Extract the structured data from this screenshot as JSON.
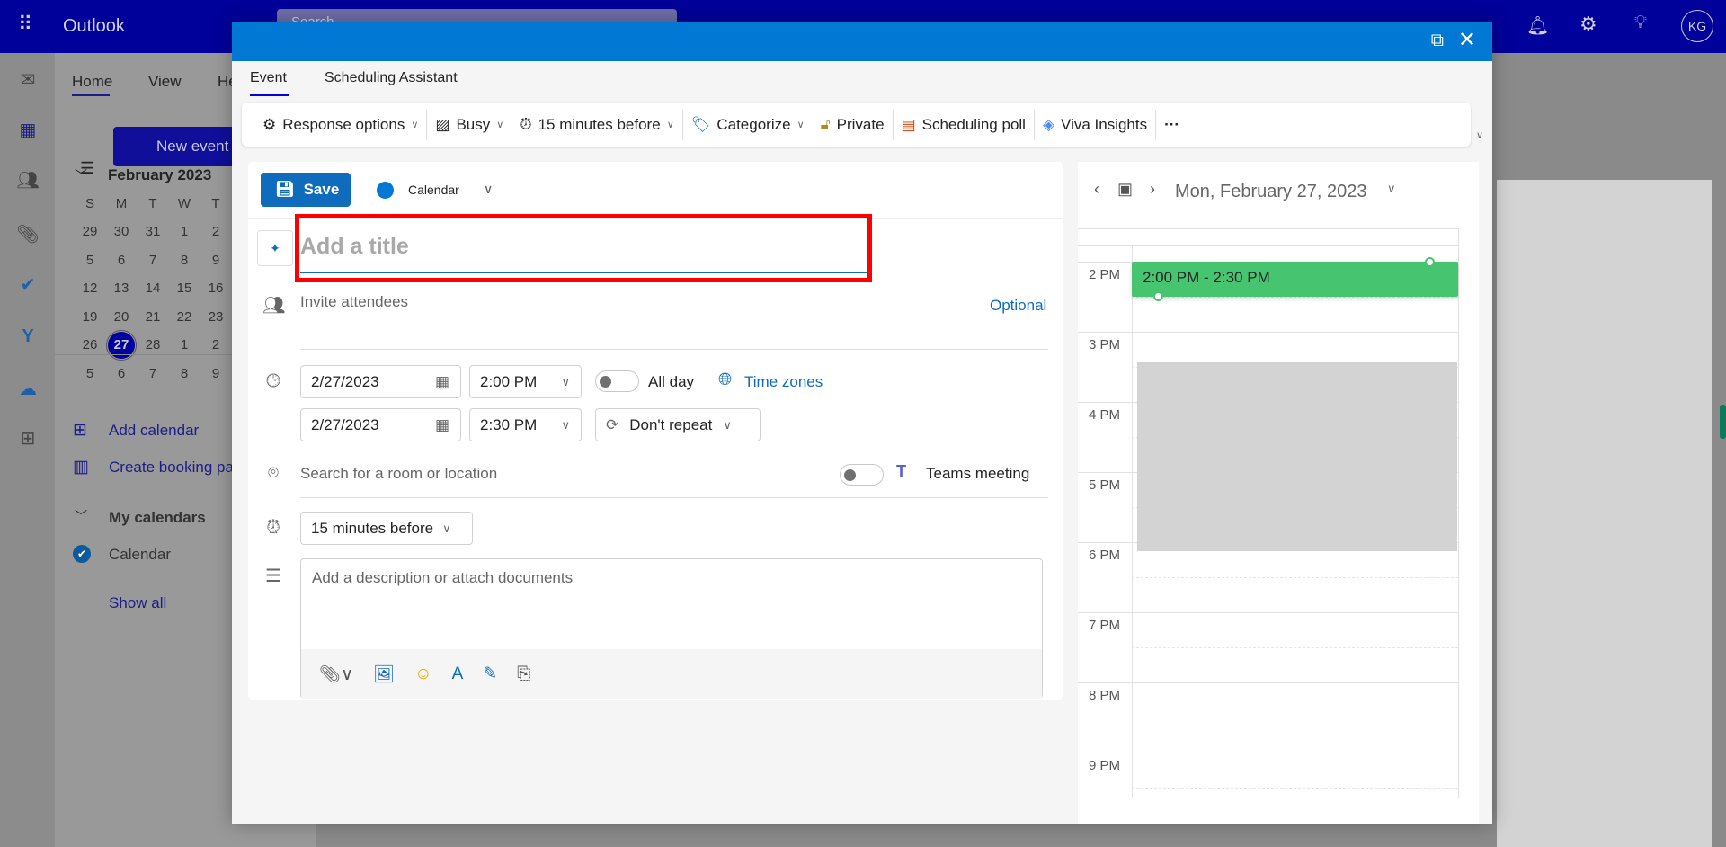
{
  "app": {
    "name": "Outlook",
    "user_initials": "KG",
    "search_placeholder": "Search"
  },
  "ribbon_tabs": [
    "Home",
    "View",
    "He"
  ],
  "new_event_label": "New event",
  "mini_calendar": {
    "title": "February 2023",
    "weekdays": [
      "S",
      "M",
      "T",
      "W",
      "T"
    ],
    "weeks": [
      [
        "29",
        "30",
        "31",
        "1",
        "2"
      ],
      [
        "5",
        "6",
        "7",
        "8",
        "9"
      ],
      [
        "12",
        "13",
        "14",
        "15",
        "16"
      ],
      [
        "19",
        "20",
        "21",
        "22",
        "23"
      ],
      [
        "26",
        "27",
        "28",
        "1",
        "2"
      ],
      [
        "5",
        "6",
        "7",
        "8",
        "9"
      ]
    ],
    "selected": "27"
  },
  "sidebar": {
    "add_calendar": "Add calendar",
    "create_booking": "Create booking pa",
    "my_calendars": "My calendars",
    "calendar": "Calendar",
    "show_all": "Show all"
  },
  "modal": {
    "tabs": [
      "Event",
      "Scheduling Assistant"
    ],
    "toolbar": {
      "response_options": "Response options",
      "busy": "Busy",
      "reminder": "15 minutes before",
      "categorize": "Categorize",
      "private": "Private",
      "scheduling_poll": "Scheduling poll",
      "viva_insights": "Viva Insights",
      "more": "···"
    },
    "save": "Save",
    "calendar_select": "Calendar",
    "calendar_color": "#0078d4",
    "title_placeholder": "Add a title",
    "invite_placeholder": "Invite attendees",
    "optional": "Optional",
    "start_date": "2/27/2023",
    "start_time": "2:00 PM",
    "end_date": "2/27/2023",
    "end_time": "2:30 PM",
    "all_day": "All day",
    "all_day_on": false,
    "time_zones": "Time zones",
    "repeat": "Don't repeat",
    "location_placeholder": "Search for a room or location",
    "teams_meeting": "Teams meeting",
    "teams_on": false,
    "reminder": "15 minutes before",
    "description_placeholder": "Add a description or attach documents"
  },
  "day_view": {
    "date": "Mon, February 27, 2023",
    "hours": [
      "2 PM",
      "3 PM",
      "4 PM",
      "5 PM",
      "6 PM",
      "7 PM",
      "8 PM",
      "9 PM"
    ],
    "event_time": "2:00 PM - 2:30 PM",
    "event_color": "#47c46f"
  }
}
